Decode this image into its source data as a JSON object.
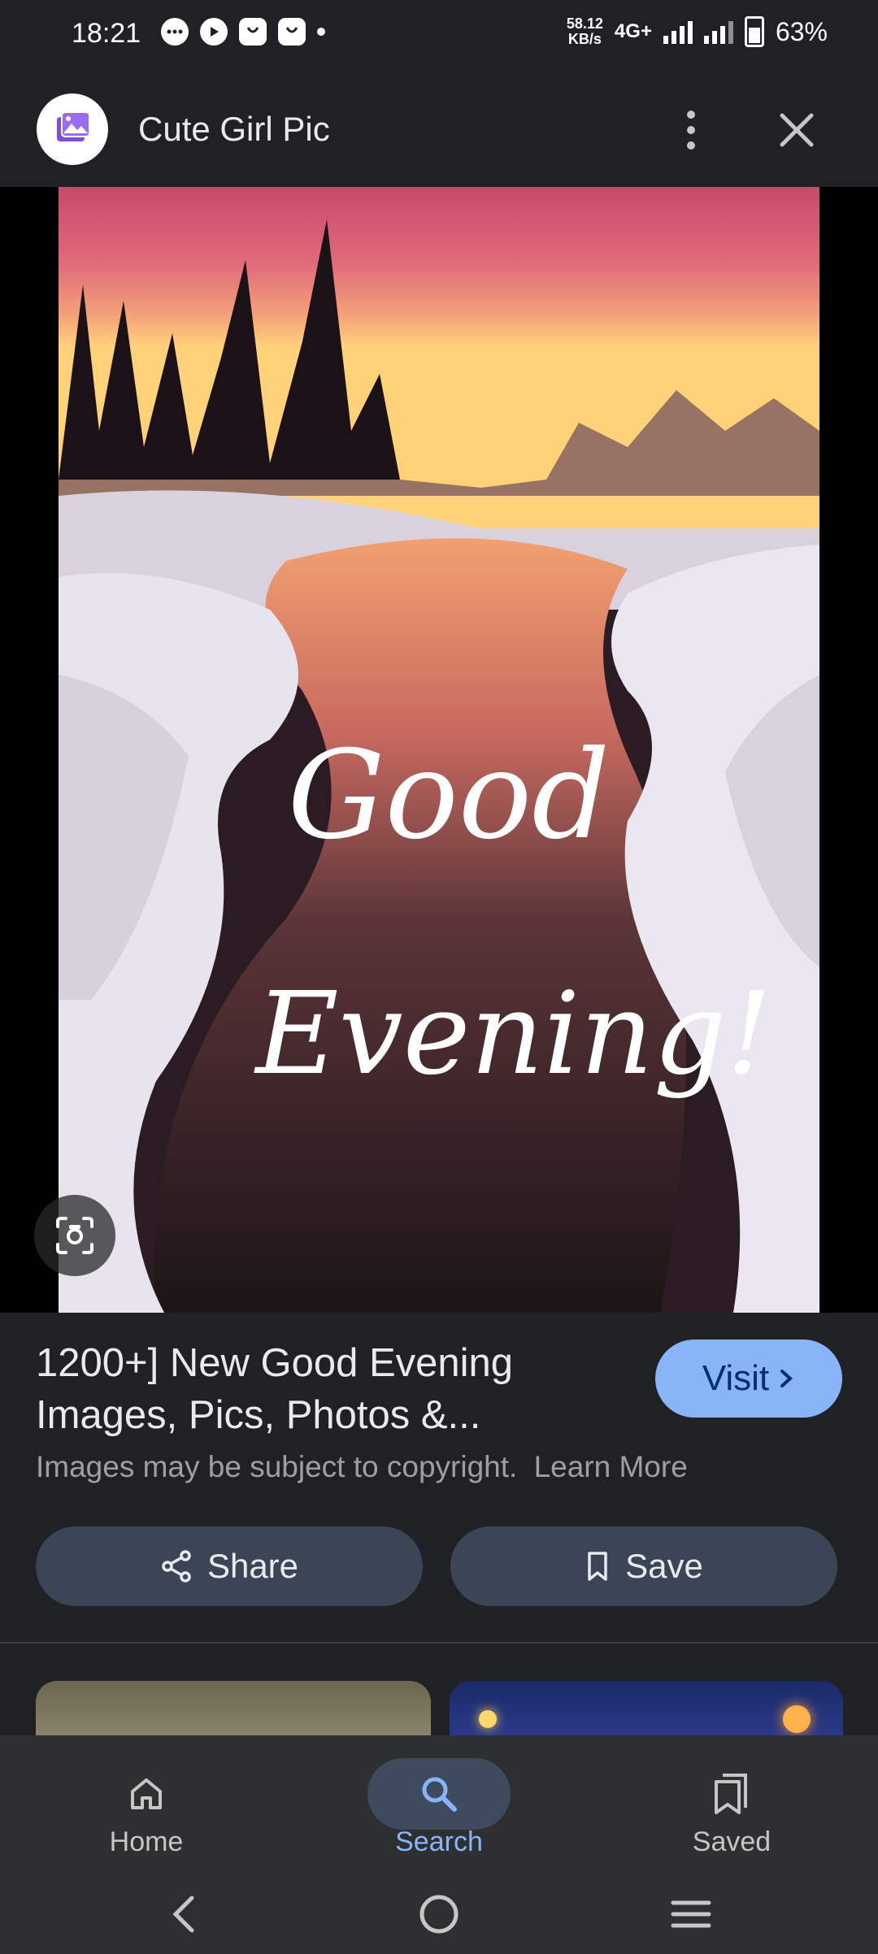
{
  "status_bar": {
    "time": "18:21",
    "speed_value": "58.12",
    "speed_unit": "KB/s",
    "network": "4G+",
    "battery": "63%",
    "icons": [
      "message-icon",
      "play-icon",
      "shopping-bag-icon",
      "shopping-bag-icon"
    ]
  },
  "header": {
    "title": "Cute Girl Pic",
    "icon": "gallery-icon",
    "more_icon": "more-vert-icon",
    "close_icon": "close-icon"
  },
  "image": {
    "overlay_line1": "Good",
    "overlay_line2": "Evening!",
    "lens_icon": "lens-icon"
  },
  "result": {
    "title": "1200+] New Good Evening Images, Pics, Photos &...",
    "visit_label": "Visit",
    "copyright_text": "Images may be subject to copyright.",
    "learn_more": "Learn More"
  },
  "actions": {
    "share_label": "Share",
    "save_label": "Save"
  },
  "bottom_nav": {
    "items": [
      {
        "label": "Home",
        "icon": "home-icon"
      },
      {
        "label": "Search",
        "icon": "search-icon",
        "active": true
      },
      {
        "label": "Saved",
        "icon": "saved-icon"
      }
    ]
  },
  "colors": {
    "background": "#202124",
    "accent": "#8ab4f8",
    "pill": "#3c4556",
    "nav": "#2d2f31"
  }
}
